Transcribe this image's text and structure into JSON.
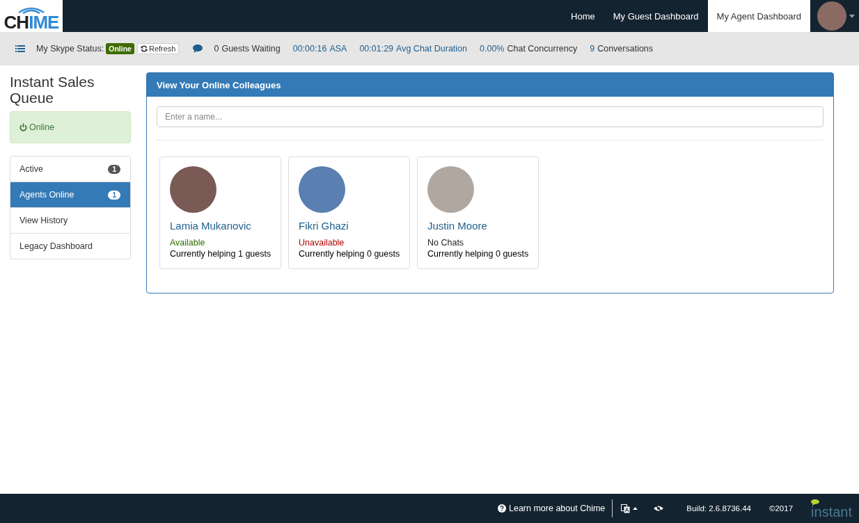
{
  "header": {
    "logo": [
      {
        "text": "CH",
        "accent": false
      },
      {
        "text": "IME",
        "accent": true
      }
    ],
    "nav": [
      {
        "label": "Home",
        "selected": false
      },
      {
        "label": "My Guest Dashboard",
        "selected": false
      },
      {
        "label": "My Agent Dashboard",
        "selected": true
      }
    ]
  },
  "toolbar": {
    "status_label": "My Skype Status:",
    "status_badge": "Online",
    "refresh_button": "Refresh",
    "stats": [
      {
        "number": "0",
        "caption": "Guests Waiting",
        "number_accent": false,
        "caption_accent": false
      },
      {
        "number": "00:00:16",
        "caption": "ASA",
        "number_accent": true,
        "caption_accent": true
      },
      {
        "number": "00:01:29",
        "caption": "Avg Chat Duration",
        "number_accent": true,
        "caption_accent": true
      },
      {
        "number": "0.00%",
        "caption": "Chat Concurrency",
        "number_accent": true,
        "caption_accent": false
      },
      {
        "number": "9",
        "caption": "Conversations",
        "number_accent": true,
        "caption_accent": false
      }
    ]
  },
  "sidebar": {
    "title": "Instant Sales Queue",
    "status": "Online",
    "items": [
      {
        "label": "Active",
        "badge": "1",
        "selected": false
      },
      {
        "label": "Agents Online",
        "badge": "1",
        "selected": true
      },
      {
        "label": "View History",
        "selected": false
      },
      {
        "label": "Legacy Dashboard",
        "selected": false
      }
    ]
  },
  "panel": {
    "title": "View Your Online Colleagues",
    "search": {
      "placeholder": "Enter a name..."
    },
    "colleagues": [
      {
        "name": "Lamia Mukanovic",
        "status": "Available",
        "color": "#2b6e00",
        "helping": "Currently helping 1 guests"
      },
      {
        "name": "Fikri Ghazi",
        "status": "Unavailable",
        "color": "#b00000",
        "helping": "Currently helping 0 guests"
      },
      {
        "name": "Justin Moore",
        "status": "No Chats",
        "color": "#222222",
        "helping": "Currently helping 0 guests"
      }
    ]
  },
  "footer": {
    "learn_more": "Learn more about Chime",
    "build": "Build: 2.6.8736.44",
    "copyright": "©2017",
    "brand": "instant"
  }
}
